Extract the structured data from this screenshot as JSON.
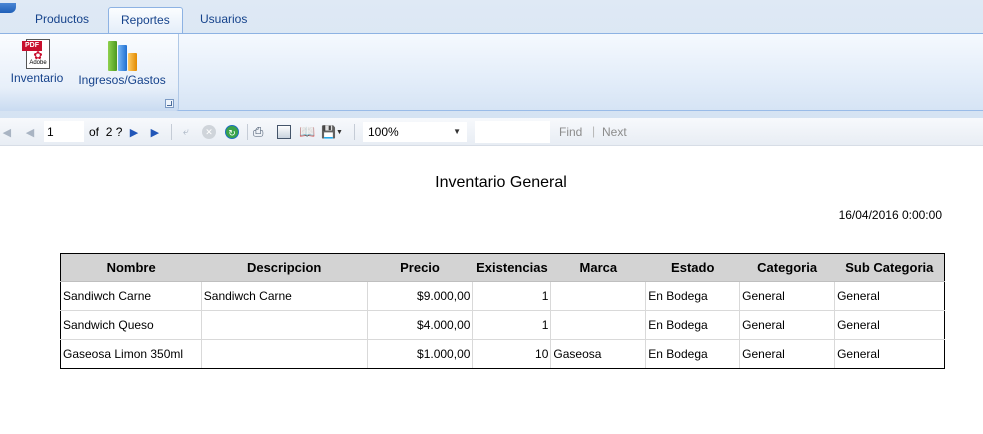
{
  "ribbon": {
    "tabs": [
      {
        "label": "Productos",
        "selected": false
      },
      {
        "label": "Reportes",
        "selected": true
      },
      {
        "label": "Usuarios",
        "selected": false
      }
    ],
    "buttons": [
      {
        "label": "Inventario",
        "icon": "pdf-icon",
        "icon_band_text": "PDF",
        "icon_brand_text": "Adobe"
      },
      {
        "label": "Ingresos/Gastos",
        "icon": "bar-chart-icon"
      }
    ]
  },
  "toolbar": {
    "current_page": "1",
    "of_label": "of",
    "total_pages": "2 ?",
    "zoom": "100%",
    "find_value": "",
    "find_label": "Find",
    "separator": "|",
    "next_label": "Next"
  },
  "report": {
    "title": "Inventario General",
    "date": "16/04/2016 0:00:00",
    "columns": [
      "Nombre",
      "Descripcion",
      "Precio",
      "Existencias",
      "Marca",
      "Estado",
      "Categoria",
      "Sub Categoria"
    ],
    "rows": [
      {
        "nombre": "Sandiwch Carne",
        "descripcion": "Sandiwch Carne",
        "precio": "$9.000,00",
        "existencias": "1",
        "marca": "",
        "estado": "En Bodega",
        "categoria": "General",
        "subcategoria": "General"
      },
      {
        "nombre": "Sandwich Queso",
        "descripcion": "",
        "precio": "$4.000,00",
        "existencias": "1",
        "marca": "",
        "estado": "En Bodega",
        "categoria": "General",
        "subcategoria": "General"
      },
      {
        "nombre": "Gaseosa Limon 350ml",
        "descripcion": "",
        "precio": "$1.000,00",
        "existencias": "10",
        "marca": "Gaseosa",
        "estado": "En Bodega",
        "categoria": "General",
        "subcategoria": "General"
      }
    ]
  },
  "colors": {
    "ribbon_text": "#15428b",
    "header_fill": "#d3d3d3",
    "disabled_nav": "#a9b4c3",
    "enabled_nav": "#2156b8"
  }
}
